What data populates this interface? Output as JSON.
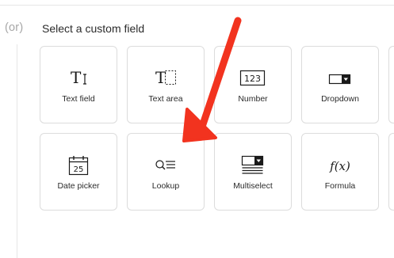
{
  "divider_text": "(or)",
  "section_title": "Select a custom field",
  "fields": [
    {
      "label": "Text field",
      "icon": "text-field-icon"
    },
    {
      "label": "Text area",
      "icon": "text-area-icon"
    },
    {
      "label": "Number",
      "icon": "number-icon",
      "icon_text": "123"
    },
    {
      "label": "Dropdown",
      "icon": "dropdown-icon"
    },
    {
      "label": "Date picker",
      "icon": "calendar-icon",
      "icon_text": "25"
    },
    {
      "label": "Lookup",
      "icon": "lookup-icon"
    },
    {
      "label": "Multiselect",
      "icon": "multiselect-icon"
    },
    {
      "label": "Formula",
      "icon": "formula-icon",
      "icon_text": "f(x)"
    }
  ],
  "colors": {
    "arrow": "#f2331f",
    "border": "#dcdcdc",
    "text": "#2b2b2b",
    "muted": "#a7a7a7"
  }
}
